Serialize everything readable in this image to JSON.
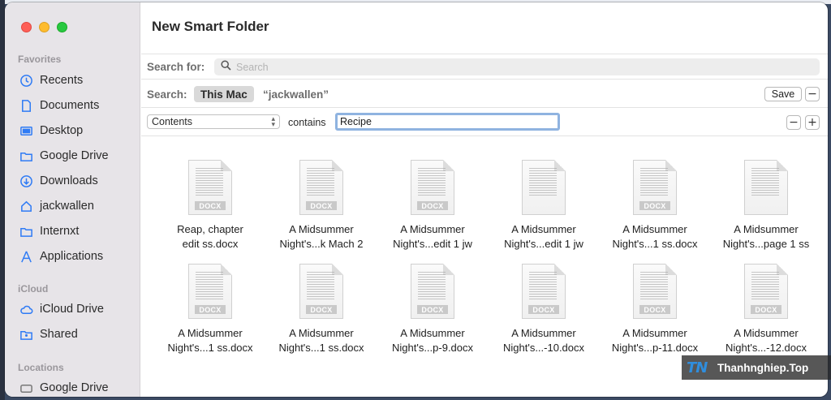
{
  "window": {
    "title": "New Smart Folder"
  },
  "sidebar": {
    "favorites_label": "Favorites",
    "favorites": [
      {
        "label": "Recents",
        "icon": "clock-icon"
      },
      {
        "label": "Documents",
        "icon": "document-icon"
      },
      {
        "label": "Desktop",
        "icon": "desktop-icon"
      },
      {
        "label": "Google Drive",
        "icon": "folder-icon"
      },
      {
        "label": "Downloads",
        "icon": "download-icon"
      },
      {
        "label": "jackwallen",
        "icon": "home-icon"
      },
      {
        "label": "Internxt",
        "icon": "folder-icon"
      },
      {
        "label": "Applications",
        "icon": "applications-icon"
      }
    ],
    "icloud_label": "iCloud",
    "icloud": [
      {
        "label": "iCloud Drive",
        "icon": "cloud-icon"
      },
      {
        "label": "Shared",
        "icon": "shared-folder-icon"
      }
    ],
    "locations_label": "Locations",
    "locations": [
      {
        "label": "Google Drive",
        "icon": "drive-icon"
      }
    ]
  },
  "search": {
    "label": "Search for:",
    "placeholder": "Search",
    "value": ""
  },
  "scope": {
    "label": "Search:",
    "this_mac": "This Mac",
    "user_scope": "“jackwallen”",
    "save_label": "Save",
    "remove_symbol": "−"
  },
  "criteria": {
    "attribute": "Contents",
    "operator": "contains",
    "value": "Recipe",
    "remove_symbol": "−",
    "add_symbol": "+"
  },
  "files": [
    {
      "line1": "Reap, chapter",
      "line2": "edit ss.docx",
      "badge": "DOCX"
    },
    {
      "line1": "A Midsummer",
      "line2": "Night's...k Mach 2",
      "badge": "DOCX"
    },
    {
      "line1": "A Midsummer",
      "line2": "Night's...edit 1 jw",
      "badge": "DOCX"
    },
    {
      "line1": "A Midsummer",
      "line2": "Night's...edit 1 jw",
      "badge": ""
    },
    {
      "line1": "A Midsummer",
      "line2": "Night's...1 ss.docx",
      "badge": "DOCX"
    },
    {
      "line1": "A Midsummer",
      "line2": "Night's...page 1 ss",
      "badge": ""
    },
    {
      "line1": "A Midsummer",
      "line2": "Night's...1 ss.docx",
      "badge": "DOCX"
    },
    {
      "line1": "A Midsummer",
      "line2": "Night's...1 ss.docx",
      "badge": "DOCX"
    },
    {
      "line1": "A Midsummer",
      "line2": "Night's...p-9.docx",
      "badge": "DOCX"
    },
    {
      "line1": "A Midsummer",
      "line2": "Night's...-10.docx",
      "badge": "DOCX"
    },
    {
      "line1": "A Midsummer",
      "line2": "Night's...p-11.docx",
      "badge": "DOCX"
    },
    {
      "line1": "A Midsummer",
      "line2": "Night's...-12.docx",
      "badge": "DOCX"
    }
  ],
  "watermark": {
    "logo": "TN",
    "text": "Thanhnghiep.Top"
  },
  "colors": {
    "accent": "#2f7bf5",
    "sidebar_bg": "#e7e4e8",
    "focus_ring": "#8fb3e0"
  }
}
